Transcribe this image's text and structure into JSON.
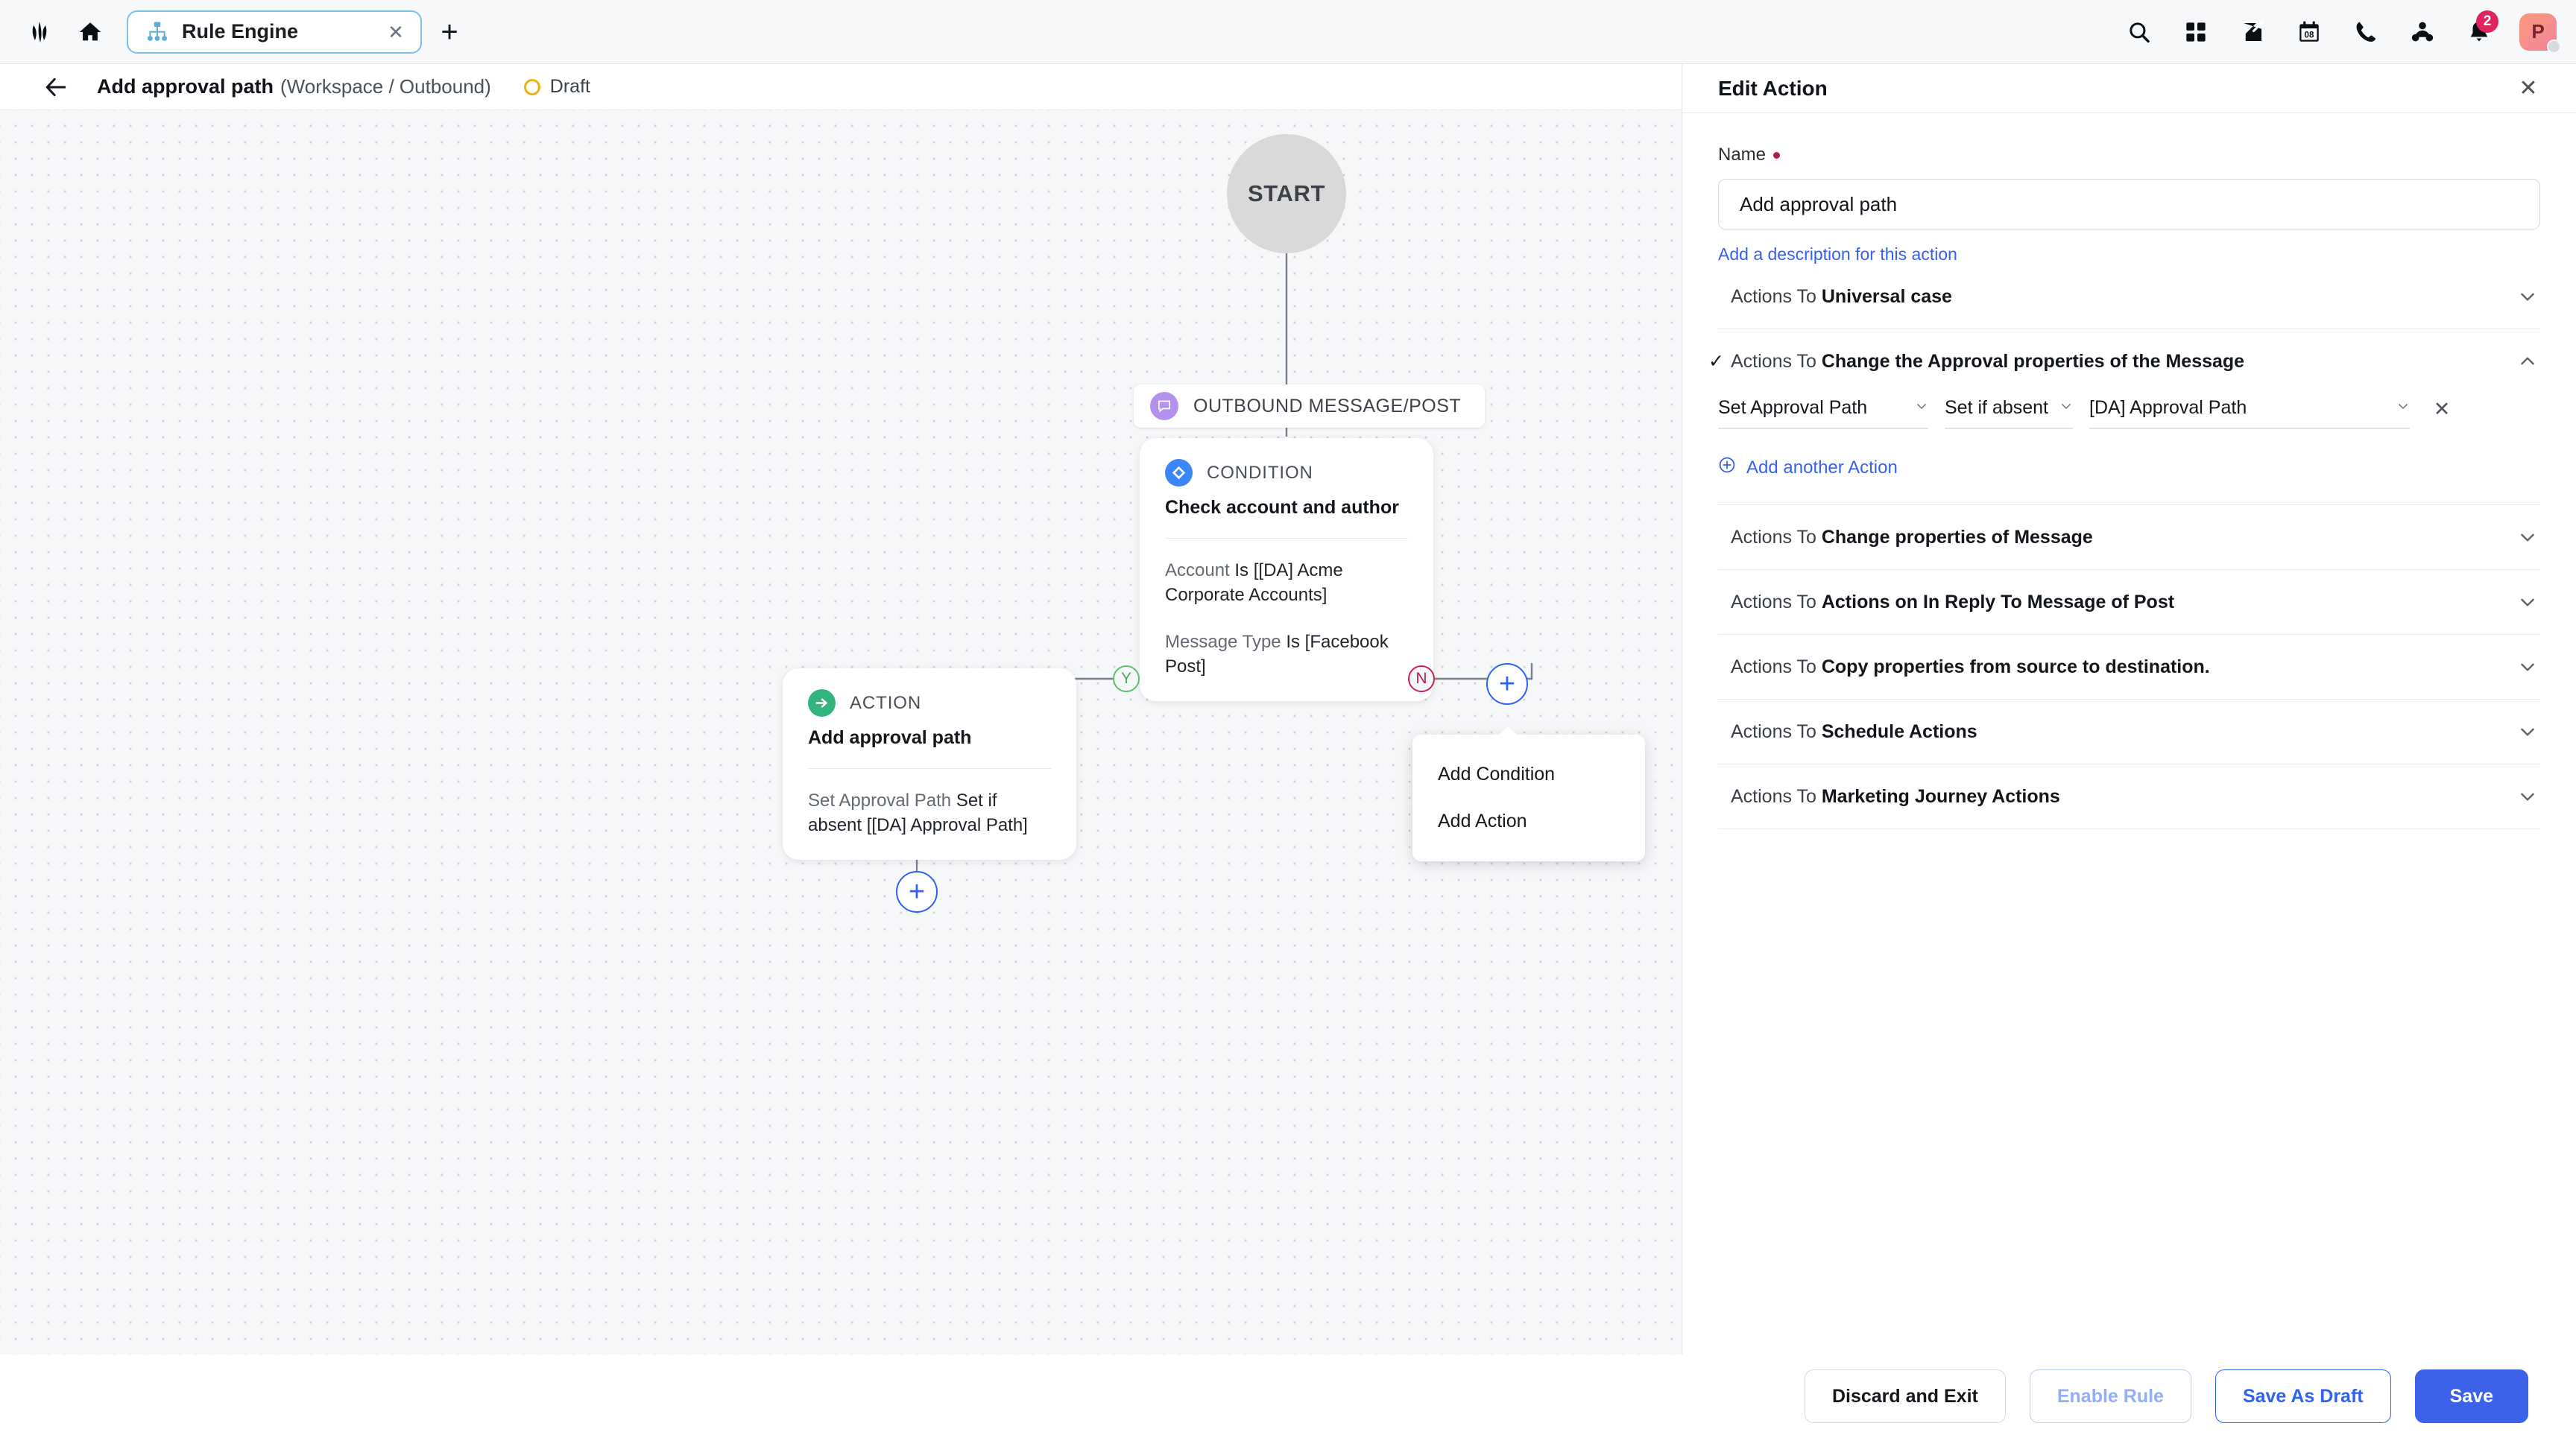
{
  "topbar": {
    "logo_icon": "sprinklr-logo-icon",
    "home_icon": "home-icon",
    "tab": {
      "icon": "hierarchy-icon",
      "label": "Rule Engine",
      "close_icon": "close-icon"
    },
    "new_tab_icon": "plus-icon",
    "right_icons": [
      {
        "name": "search-icon"
      },
      {
        "name": "apps-grid-icon"
      },
      {
        "name": "compose-icon"
      },
      {
        "name": "calendar-icon",
        "day": "08"
      },
      {
        "name": "phone-icon"
      },
      {
        "name": "collaboration-icon"
      },
      {
        "name": "bell-icon",
        "badge": "2"
      }
    ],
    "avatar": {
      "initial": "P"
    }
  },
  "page_header": {
    "back_icon": "back-arrow-icon",
    "title": "Add approval path",
    "scope": "(Workspace / Outbound)",
    "status": "Draft",
    "status_color": "#eeb111"
  },
  "canvas": {
    "start_label": "START",
    "trigger": {
      "icon": "message-bubble-icon",
      "label": "OUTBOUND MESSAGE/POST",
      "icon_color": "#b490ef"
    },
    "condition_node": {
      "kind": "CONDITION",
      "badge_icon": "diamond-icon",
      "badge_color": "#3b86f7",
      "title": "Check account and author",
      "rules": [
        {
          "field": "Account",
          "op": "Is",
          "value": "[[DA] Acme Corporate Accounts]"
        },
        {
          "field": "Message Type",
          "op": "Is",
          "value": "[Facebook Post]"
        }
      ]
    },
    "action_node": {
      "kind": "ACTION",
      "badge_icon": "arrow-right-circle-icon",
      "badge_color": "#35b47e",
      "title": "Add approval path",
      "rules": [
        {
          "field": "Set Approval Path",
          "op": "Set if absent",
          "value": "[[DA] Approval Path]"
        }
      ]
    },
    "branch_yes": "Y",
    "branch_no": "N",
    "add_menu": {
      "items": [
        "Add Condition",
        "Add Action"
      ]
    }
  },
  "panel": {
    "title": "Edit Action",
    "close_icon": "close-icon",
    "name_label": "Name",
    "name_value": "Add approval path",
    "name_placeholder": "Name",
    "description_link": "Add a description for this action",
    "sections": [
      {
        "prefix": "Actions To",
        "name": "Universal case",
        "expanded": false,
        "checked": false
      },
      {
        "prefix": "Actions To",
        "name": "Change the Approval properties of the Message",
        "expanded": true,
        "checked": true
      },
      {
        "prefix": "Actions To",
        "name": "Change properties of Message",
        "expanded": false,
        "checked": false
      },
      {
        "prefix": "Actions To",
        "name": "Actions on In Reply To Message of Post",
        "expanded": false,
        "checked": false
      },
      {
        "prefix": "Actions To",
        "name": "Copy properties from source to destination.",
        "expanded": false,
        "checked": false
      },
      {
        "prefix": "Actions To",
        "name": "Schedule Actions",
        "expanded": false,
        "checked": false
      },
      {
        "prefix": "Actions To",
        "name": "Marketing Journey Actions",
        "expanded": false,
        "checked": false
      }
    ],
    "action_row": {
      "property": "Set Approval Path",
      "mode": "Set if absent",
      "value": "[DA] Approval Path",
      "remove_icon": "close-icon"
    },
    "add_another_label": "Add another Action"
  },
  "footer": {
    "discard_label": "Discard and Exit",
    "enable_label": "Enable Rule",
    "draft_label": "Save As Draft",
    "save_label": "Save"
  }
}
